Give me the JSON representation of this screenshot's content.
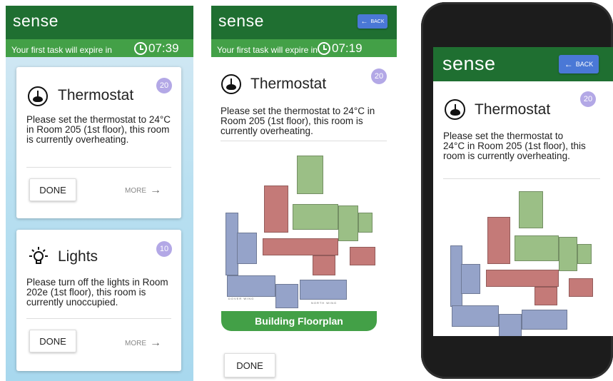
{
  "app": {
    "brand": "sense"
  },
  "timer": {
    "label": "Your first task will expire in",
    "time_1": "07:39",
    "time_2": "07:19"
  },
  "back_label": "BACK",
  "tasks": [
    {
      "title": "Thermostat",
      "points": "20",
      "description": "Please set the thermostat to 24°C in Room 205 (1st floor), this room is currently overheating."
    },
    {
      "title": "Lights",
      "points": "10",
      "description": "Please turn off the lights in Room 202e (1st floor), this room is currently unoccupied."
    }
  ],
  "actions": {
    "done": "DONE",
    "more": "MORE"
  },
  "floorplan": {
    "caption": "Building Floorplan",
    "label_dover": "DOVER WING",
    "label_north": "NORTH WING"
  },
  "colors": {
    "appbar": "#1f6f31",
    "timerbar": "#43a047",
    "badge": "#b3a8e6",
    "back_button": "#4a78d6"
  },
  "icons": [
    "clock-icon",
    "thermostat-icon",
    "lightbulb-icon",
    "arrow-right-icon",
    "arrow-left-icon"
  ]
}
